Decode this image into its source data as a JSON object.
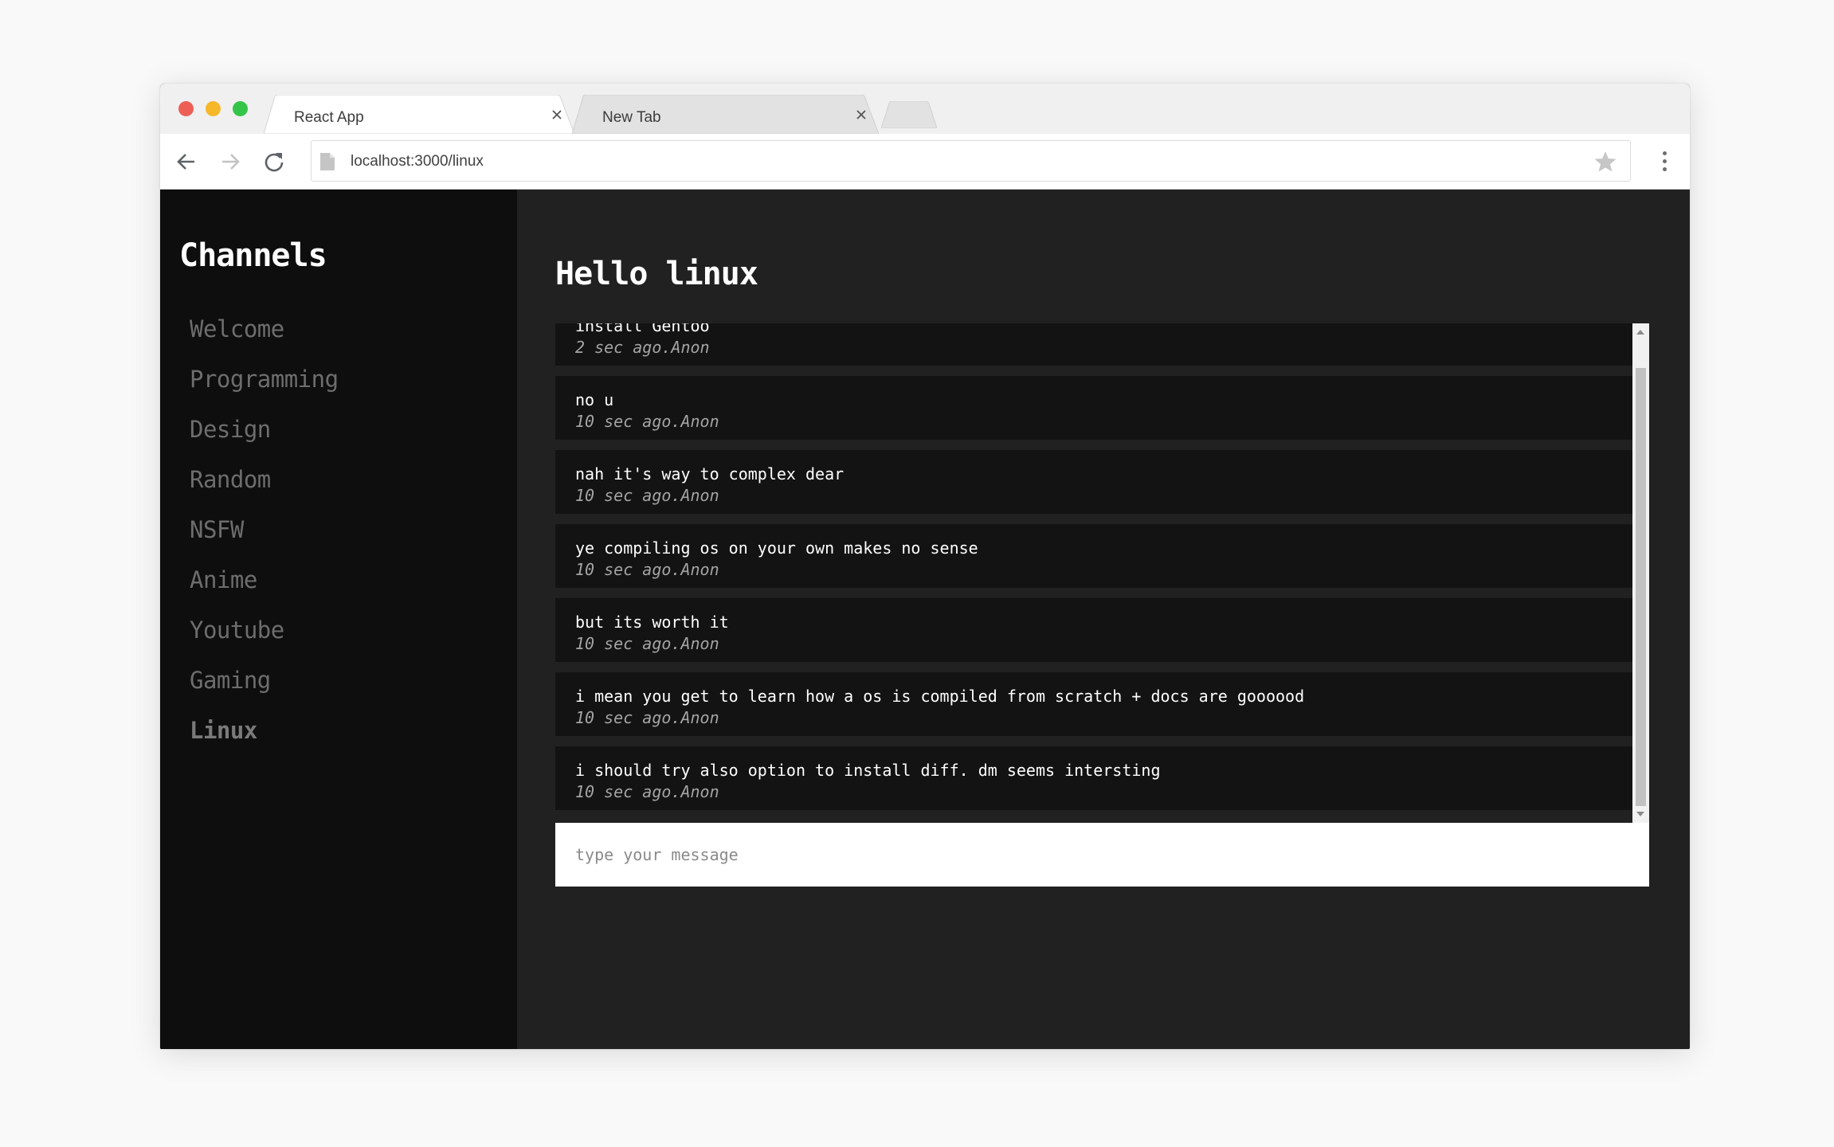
{
  "browser": {
    "tabs": [
      {
        "title": "React App",
        "active": true
      },
      {
        "title": "New Tab",
        "active": false
      }
    ],
    "url": "localhost:3000/linux"
  },
  "sidebar": {
    "title": "Channels",
    "channels": [
      {
        "label": "Welcome"
      },
      {
        "label": "Programming"
      },
      {
        "label": "Design"
      },
      {
        "label": "Random"
      },
      {
        "label": "NSFW"
      },
      {
        "label": "Anime"
      },
      {
        "label": "Youtube"
      },
      {
        "label": "Gaming"
      },
      {
        "label": "Linux",
        "active": true
      }
    ]
  },
  "main": {
    "title": "Hello linux",
    "messages": [
      {
        "text": "install Gentoo",
        "meta": "2 sec ago.Anon"
      },
      {
        "text": "no u",
        "meta": "10 sec ago.Anon"
      },
      {
        "text": "nah it's way to complex dear",
        "meta": "10 sec ago.Anon"
      },
      {
        "text": "ye compiling os on your own makes no sense",
        "meta": "10 sec ago.Anon"
      },
      {
        "text": "but its worth it",
        "meta": "10 sec ago.Anon"
      },
      {
        "text": "i mean you get to learn how a os is compiled from scratch + docs are goooood",
        "meta": "10 sec ago.Anon"
      },
      {
        "text": "i should try also option to install diff. dm seems intersting",
        "meta": "10 sec ago.Anon"
      }
    ],
    "input": {
      "placeholder": "type your message",
      "value": ""
    }
  }
}
